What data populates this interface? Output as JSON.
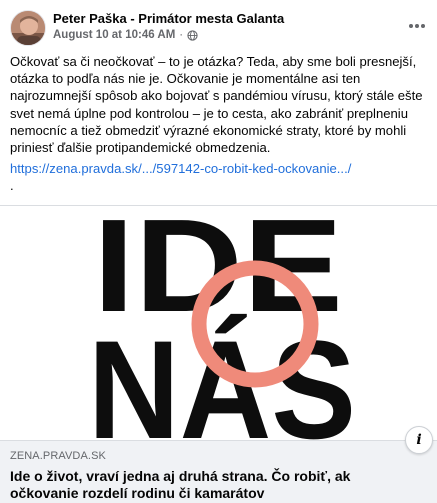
{
  "post": {
    "author": "Peter Paška - Primátor mesta Galanta",
    "date": "August 10 at 10:46 AM",
    "separator": "·",
    "privacy_icon": "globe-icon",
    "more_icon": "more-horizontal-icon",
    "text": "Očkovať sa či neočkovať – to je otázka? Teda, aby sme boli presnejší, otázka to podľa nás nie je. Očkovanie je momentálne asi ten najrozumnejší spôsob ako bojovať s pandémiou vírusu, ktorý stále ešte svet nemá úplne pod kontrolou – je to cesta, ako zabrániť preplneniu nemocníc a tiež obmedziť výrazné ekonomické straty, ktoré by mohli priniesť ďalšie protipandemické obmedzenia.",
    "link": "https://zena.pravda.sk/.../597142-co-robit-ked-ockovanie.../",
    "trailing": "."
  },
  "preview": {
    "image_text": {
      "line1": "IDE",
      "line2": "NÁS",
      "ring_letter": "O"
    },
    "colors": {
      "text": "#0d0d0d",
      "ring": "#ef8a7a"
    }
  },
  "link_card": {
    "domain": "ZENA.PRAVDA.SK",
    "title": "Ide o život, vraví jedna aj druhá strana. Čo robiť, ak očkovanie rozdelí rodinu či kamarátov",
    "info_icon": "info-icon",
    "info_glyph": "i"
  }
}
